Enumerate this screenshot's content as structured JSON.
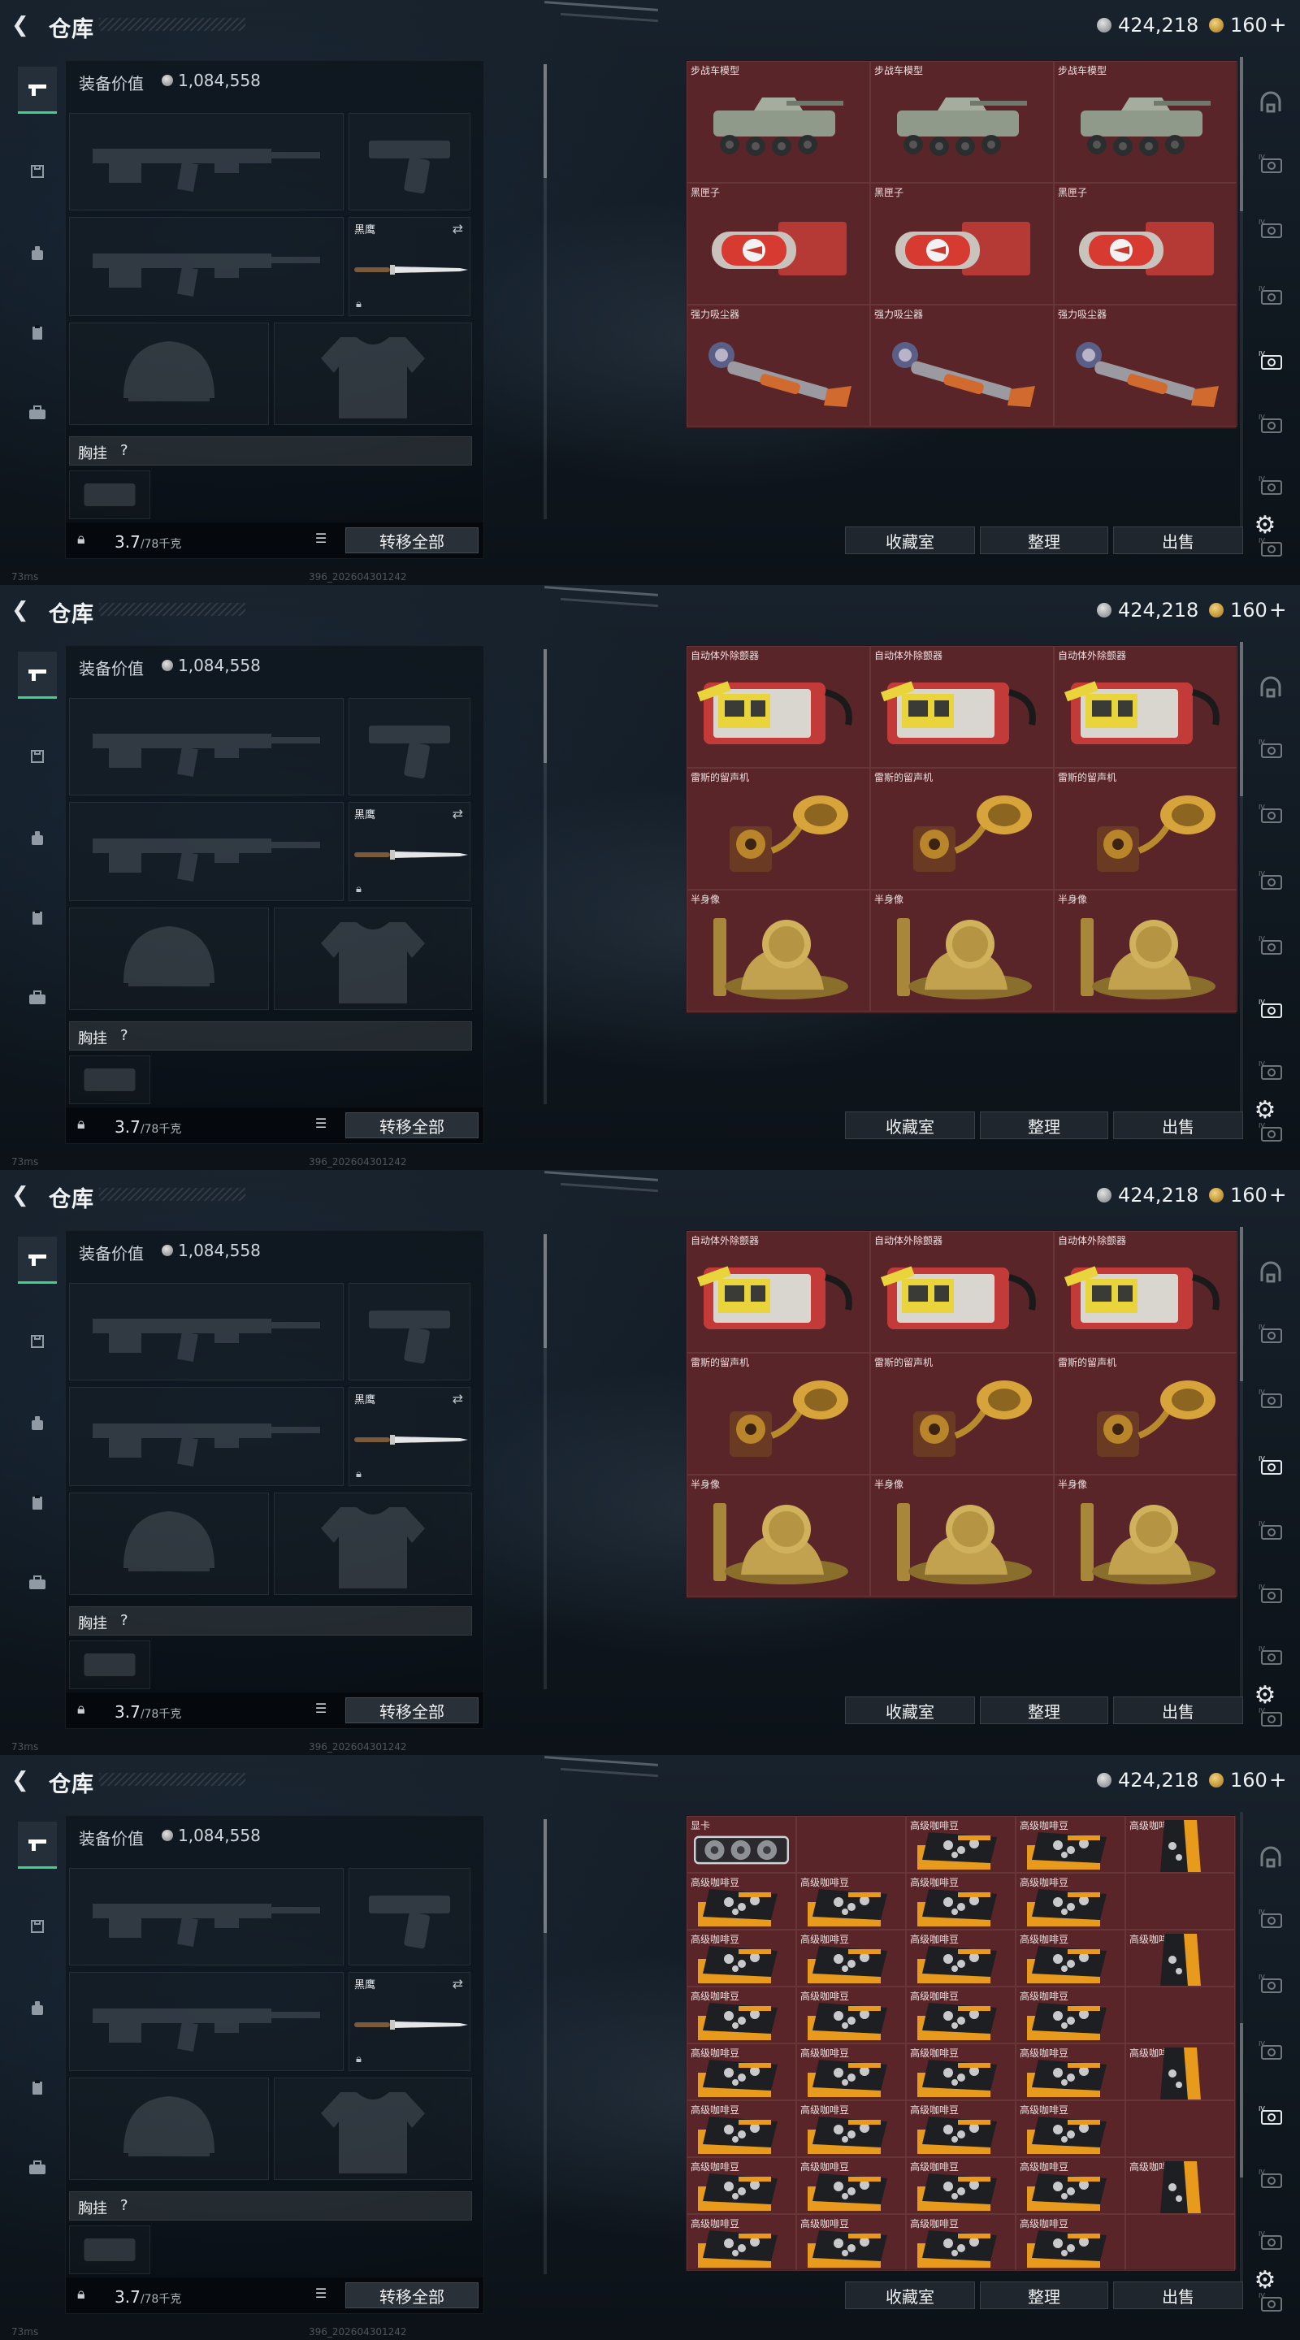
{
  "common": {
    "title": "仓库",
    "silver": "424,218",
    "gold": "160",
    "gold_suffix": "+",
    "equip_label": "装备价值",
    "equip_value": "1,084,558",
    "knife_label": "黑鹰",
    "chest_label": "胸挂",
    "chest_q": "?",
    "weight": "3.7",
    "weight_max": "/78千克",
    "transfer_all": "转移全部",
    "btn_collect": "收藏室",
    "btn_sort": "整理",
    "btn_sell": "出售",
    "ping": "73ms",
    "build": "396_202604301242"
  },
  "panels": [
    {
      "cols": 3,
      "rows": 3,
      "active_side": 4,
      "items": [
        {
          "name": "步战车模型",
          "art": "ifv"
        },
        {
          "name": "步战车模型",
          "art": "ifv"
        },
        {
          "name": "步战车模型",
          "art": "ifv"
        },
        {
          "name": "黑匣子",
          "art": "blackbox"
        },
        {
          "name": "黑匣子",
          "art": "blackbox"
        },
        {
          "name": "黑匣子",
          "art": "blackbox"
        },
        {
          "name": "强力吸尘器",
          "art": "vacuum"
        },
        {
          "name": "强力吸尘器",
          "art": "vacuum"
        },
        {
          "name": "强力吸尘器",
          "art": "vacuum"
        }
      ]
    },
    {
      "cols": 3,
      "rows": 3,
      "active_side": 5,
      "items": [
        {
          "name": "自动体外除颤器",
          "art": "aed"
        },
        {
          "name": "自动体外除颤器",
          "art": "aed"
        },
        {
          "name": "自动体外除颤器",
          "art": "aed"
        },
        {
          "name": "雷斯的留声机",
          "art": "gramophone"
        },
        {
          "name": "雷斯的留声机",
          "art": "gramophone"
        },
        {
          "name": "雷斯的留声机",
          "art": "gramophone"
        },
        {
          "name": "半身像",
          "art": "bust"
        },
        {
          "name": "半身像",
          "art": "bust"
        },
        {
          "name": "半身像",
          "art": "bust"
        }
      ]
    },
    {
      "cols": 3,
      "rows": 3,
      "active_side": 3,
      "items": [
        {
          "name": "自动体外除颤器",
          "art": "aed"
        },
        {
          "name": "自动体外除颤器",
          "art": "aed"
        },
        {
          "name": "自动体外除颤器",
          "art": "aed"
        },
        {
          "name": "雷斯的留声机",
          "art": "gramophone"
        },
        {
          "name": "雷斯的留声机",
          "art": "gramophone"
        },
        {
          "name": "雷斯的留声机",
          "art": "gramophone"
        },
        {
          "name": "半身像",
          "art": "bust"
        },
        {
          "name": "半身像",
          "art": "bust"
        },
        {
          "name": "半身像",
          "art": "bust"
        }
      ]
    },
    {
      "cols": 5,
      "rows": 8,
      "active_side": 4,
      "items": [
        {
          "name": "显卡",
          "art": "gpu"
        },
        {
          "name": "",
          "art": "none"
        },
        {
          "name": "高级咖啡豆",
          "art": "coffee"
        },
        {
          "name": "高级咖啡豆",
          "art": "coffee"
        },
        {
          "name": "高级咖啡豆",
          "art": "coffeebag"
        },
        {
          "name": "高级咖啡豆",
          "art": "coffee"
        },
        {
          "name": "高级咖啡豆",
          "art": "coffee"
        },
        {
          "name": "高级咖啡豆",
          "art": "coffee"
        },
        {
          "name": "高级咖啡豆",
          "art": "coffee"
        },
        {
          "name": "",
          "art": "none"
        },
        {
          "name": "高级咖啡豆",
          "art": "coffee"
        },
        {
          "name": "高级咖啡豆",
          "art": "coffee"
        },
        {
          "name": "高级咖啡豆",
          "art": "coffee"
        },
        {
          "name": "高级咖啡豆",
          "art": "coffee"
        },
        {
          "name": "高级咖啡豆",
          "art": "coffeebag"
        },
        {
          "name": "高级咖啡豆",
          "art": "coffee"
        },
        {
          "name": "高级咖啡豆",
          "art": "coffee"
        },
        {
          "name": "高级咖啡豆",
          "art": "coffee"
        },
        {
          "name": "高级咖啡豆",
          "art": "coffee"
        },
        {
          "name": "",
          "art": "none"
        },
        {
          "name": "高级咖啡豆",
          "art": "coffee"
        },
        {
          "name": "高级咖啡豆",
          "art": "coffee"
        },
        {
          "name": "高级咖啡豆",
          "art": "coffee"
        },
        {
          "name": "高级咖啡豆",
          "art": "coffee"
        },
        {
          "name": "高级咖啡豆",
          "art": "coffeebag"
        },
        {
          "name": "高级咖啡豆",
          "art": "coffee"
        },
        {
          "name": "高级咖啡豆",
          "art": "coffee"
        },
        {
          "name": "高级咖啡豆",
          "art": "coffee"
        },
        {
          "name": "高级咖啡豆",
          "art": "coffee"
        },
        {
          "name": "",
          "art": "none"
        },
        {
          "name": "高级咖啡豆",
          "art": "coffee"
        },
        {
          "name": "高级咖啡豆",
          "art": "coffee"
        },
        {
          "name": "高级咖啡豆",
          "art": "coffee"
        },
        {
          "name": "高级咖啡豆",
          "art": "coffee"
        },
        {
          "name": "高级咖啡豆",
          "art": "coffeebag"
        },
        {
          "name": "高级咖啡豆",
          "art": "coffee"
        },
        {
          "name": "高级咖啡豆",
          "art": "coffee"
        },
        {
          "name": "高级咖啡豆",
          "art": "coffee"
        },
        {
          "name": "高级咖啡豆",
          "art": "coffee"
        },
        {
          "name": "",
          "art": "none"
        }
      ]
    }
  ],
  "colors": {
    "accent": "#3bd28c",
    "storage_bg": "#4a2326",
    "item_bg": "#6e282d"
  },
  "icons": {
    "left_rail": [
      "rifle-icon",
      "vest-icon",
      "backpack-icon",
      "clipboard-icon",
      "briefcase-icon"
    ],
    "right_rail": [
      "arch-icon",
      "tv-icon",
      "tv-icon",
      "tv-icon",
      "tv-icon",
      "tv-icon",
      "tv-icon",
      "tv-icon"
    ]
  }
}
